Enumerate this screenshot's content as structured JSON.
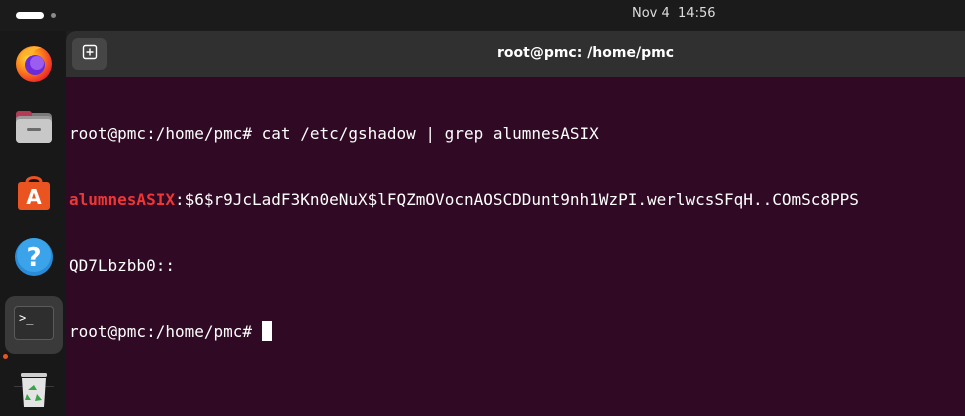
{
  "topbar": {
    "clock": "Nov 4  14:56"
  },
  "dock": {
    "items": [
      {
        "name": "firefox-icon"
      },
      {
        "name": "files-icon"
      },
      {
        "name": "app-center-icon"
      },
      {
        "name": "help-icon"
      },
      {
        "name": "terminal-icon"
      },
      {
        "name": "trash-icon"
      }
    ],
    "colors": {
      "running_indicator": "#e95420"
    }
  },
  "window": {
    "title": "root@pmc: /home/pmc",
    "background": "#300a24"
  },
  "terminal": {
    "line1": "root@pmc:/home/pmc# cat /etc/gshadow | grep alumnesASIX",
    "line2_user": "alumnesASIX",
    "line2_rest": ":$6$r9JcLadF3Kn0eNuX$lFQZmOVocnAOSCDDunt9nh1WzPI.werlwcsSFqH..COmSc8PPS",
    "line3": "QD7Lbzbb0::",
    "prompt": "root@pmc:/home/pmc# "
  }
}
